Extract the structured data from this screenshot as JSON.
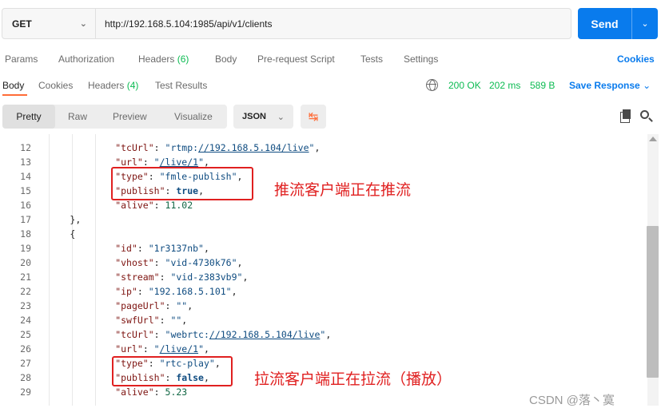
{
  "request": {
    "method": "GET",
    "url": "http://192.168.5.104:1985/api/v1/clients",
    "send_label": "Send"
  },
  "request_tabs": {
    "params": "Params",
    "authorization": "Authorization",
    "headers": "Headers",
    "headers_count": "(6)",
    "body": "Body",
    "prerequest": "Pre-request Script",
    "tests": "Tests",
    "settings": "Settings",
    "cookies": "Cookies"
  },
  "response_tabs": {
    "body": "Body",
    "cookies": "Cookies",
    "headers": "Headers",
    "headers_count": "(4)",
    "test_results": "Test Results",
    "status": "200 OK",
    "time": "202 ms",
    "size": "589 B",
    "save_response": "Save Response"
  },
  "view": {
    "pretty": "Pretty",
    "raw": "Raw",
    "preview": "Preview",
    "visualize": "Visualize",
    "format": "JSON"
  },
  "code_lines": [
    {
      "n": "12",
      "t": "\"tcUrl\": \"rtmp://192.168.5.104/live\","
    },
    {
      "n": "13",
      "t": "\"url\": \"/live/1\","
    },
    {
      "n": "14",
      "t": "\"type\": \"fmle-publish\","
    },
    {
      "n": "15",
      "t": "\"publish\": true,"
    },
    {
      "n": "16",
      "t": "\"alive\": 11.02"
    },
    {
      "n": "17",
      "t": "},"
    },
    {
      "n": "18",
      "t": "{"
    },
    {
      "n": "19",
      "t": "\"id\": \"1r3137nb\","
    },
    {
      "n": "20",
      "t": "\"vhost\": \"vid-4730k76\","
    },
    {
      "n": "21",
      "t": "\"stream\": \"vid-z383vb9\","
    },
    {
      "n": "22",
      "t": "\"ip\": \"192.168.5.101\","
    },
    {
      "n": "23",
      "t": "\"pageUrl\": \"\","
    },
    {
      "n": "24",
      "t": "\"swfUrl\": \"\","
    },
    {
      "n": "25",
      "t": "\"tcUrl\": \"webrtc://192.168.5.104/live\","
    },
    {
      "n": "26",
      "t": "\"url\": \"/live/1\","
    },
    {
      "n": "27",
      "t": "\"type\": \"rtc-play\","
    },
    {
      "n": "28",
      "t": "\"publish\": false,"
    },
    {
      "n": "29",
      "t": "\"alive\": 5.23"
    }
  ],
  "annotations": {
    "publisher": "推流客户端正在推流",
    "player": "拉流客户端正在拉流（播放）"
  },
  "watermark": "CSDN @落丶寞",
  "colors": {
    "accent": "#097bed",
    "brand_orange": "#ff6c37",
    "status_green": "#0cbb52",
    "annotation_red": "#e02020"
  }
}
